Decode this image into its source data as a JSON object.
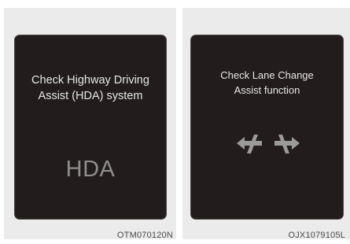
{
  "left_panel": {
    "message": "Check Highway Driving\nAssist (HDA) system",
    "display_text": "HDA",
    "code": "OTM070120N"
  },
  "right_panel": {
    "message": "Check Lane Change\nAssist function",
    "icon": "lane-change-arrows-icon",
    "code": "OJX1079105L"
  },
  "colors": {
    "screen": "#221d1c",
    "text": "#e6e6e6",
    "muted": "#8e8e8e",
    "panel": "#ebebeb"
  }
}
